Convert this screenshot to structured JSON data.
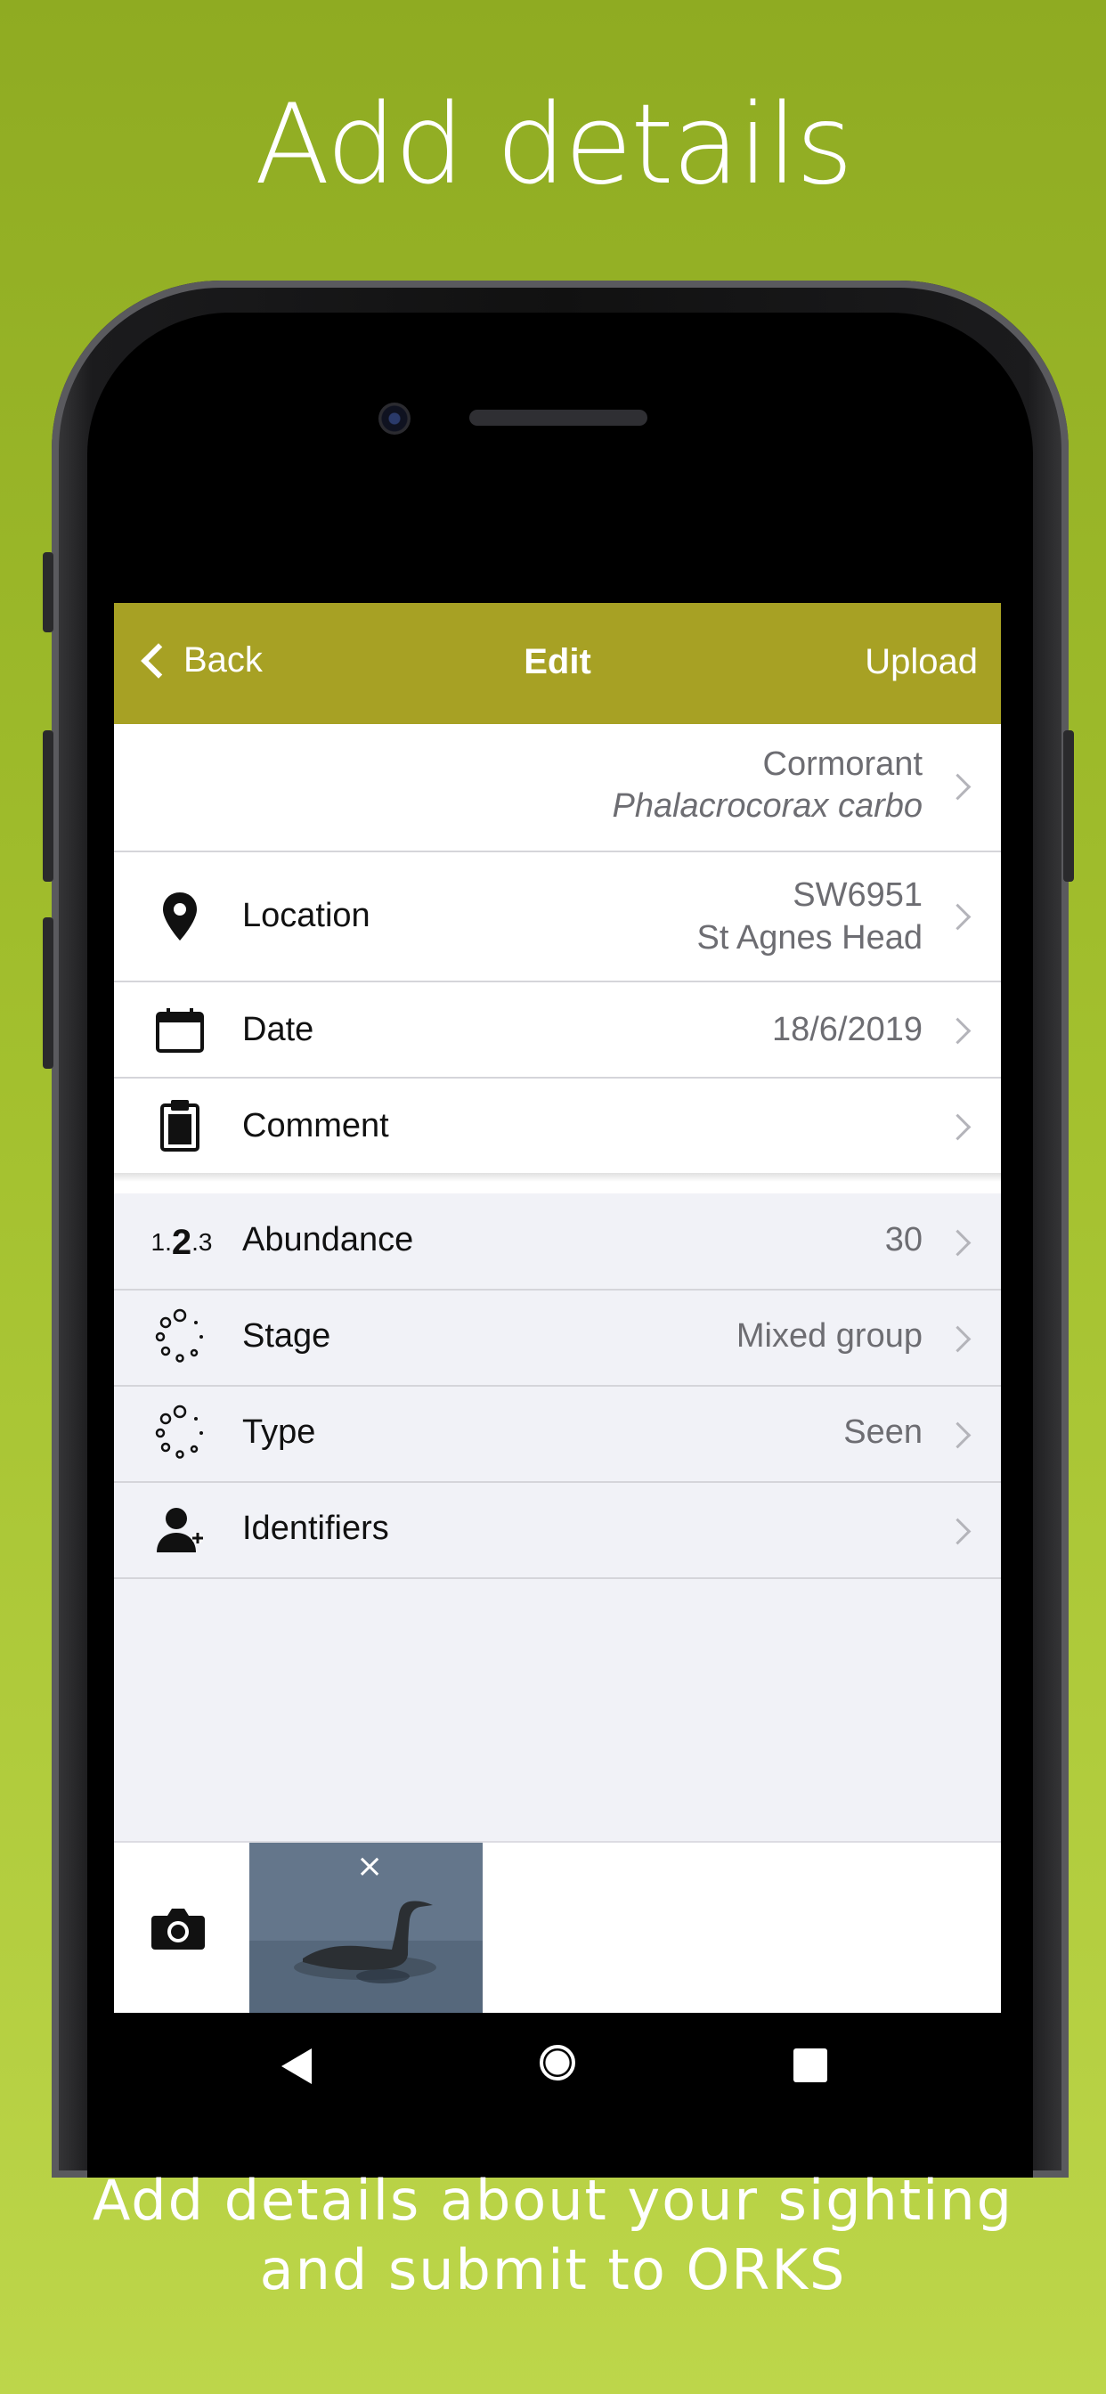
{
  "promo": {
    "headline": "Add details",
    "caption_line1": "Add details about your sighting",
    "caption_line2": "and submit to ORKS"
  },
  "navbar": {
    "back_label": "Back",
    "title": "Edit",
    "upload_label": "Upload",
    "color": "#a7a124"
  },
  "species": {
    "common_name": "Cormorant",
    "latin_name": "Phalacrocorax carbo"
  },
  "core_fields": [
    {
      "label": "Location",
      "value_line1": "SW6951",
      "value_line2": "St Agnes Head",
      "icon": "location-pin-icon"
    },
    {
      "label": "Date",
      "value": "18/6/2019",
      "icon": "calendar-icon"
    },
    {
      "label": "Comment",
      "value": "",
      "icon": "clipboard-icon"
    }
  ],
  "extra_fields": [
    {
      "label": "Abundance",
      "value": "30",
      "icon": "number-icon"
    },
    {
      "label": "Stage",
      "value": "Mixed group",
      "icon": "dots-circle-icon"
    },
    {
      "label": "Type",
      "value": "Seen",
      "icon": "dots-circle-icon"
    },
    {
      "label": "Identifiers",
      "value": "",
      "icon": "person-add-icon"
    }
  ],
  "icon_text": {
    "abundance_digits_a": "1.",
    "abundance_digits_b": "2",
    "abundance_digits_c": ".3"
  },
  "photos": {
    "remove_glyph": "×"
  }
}
